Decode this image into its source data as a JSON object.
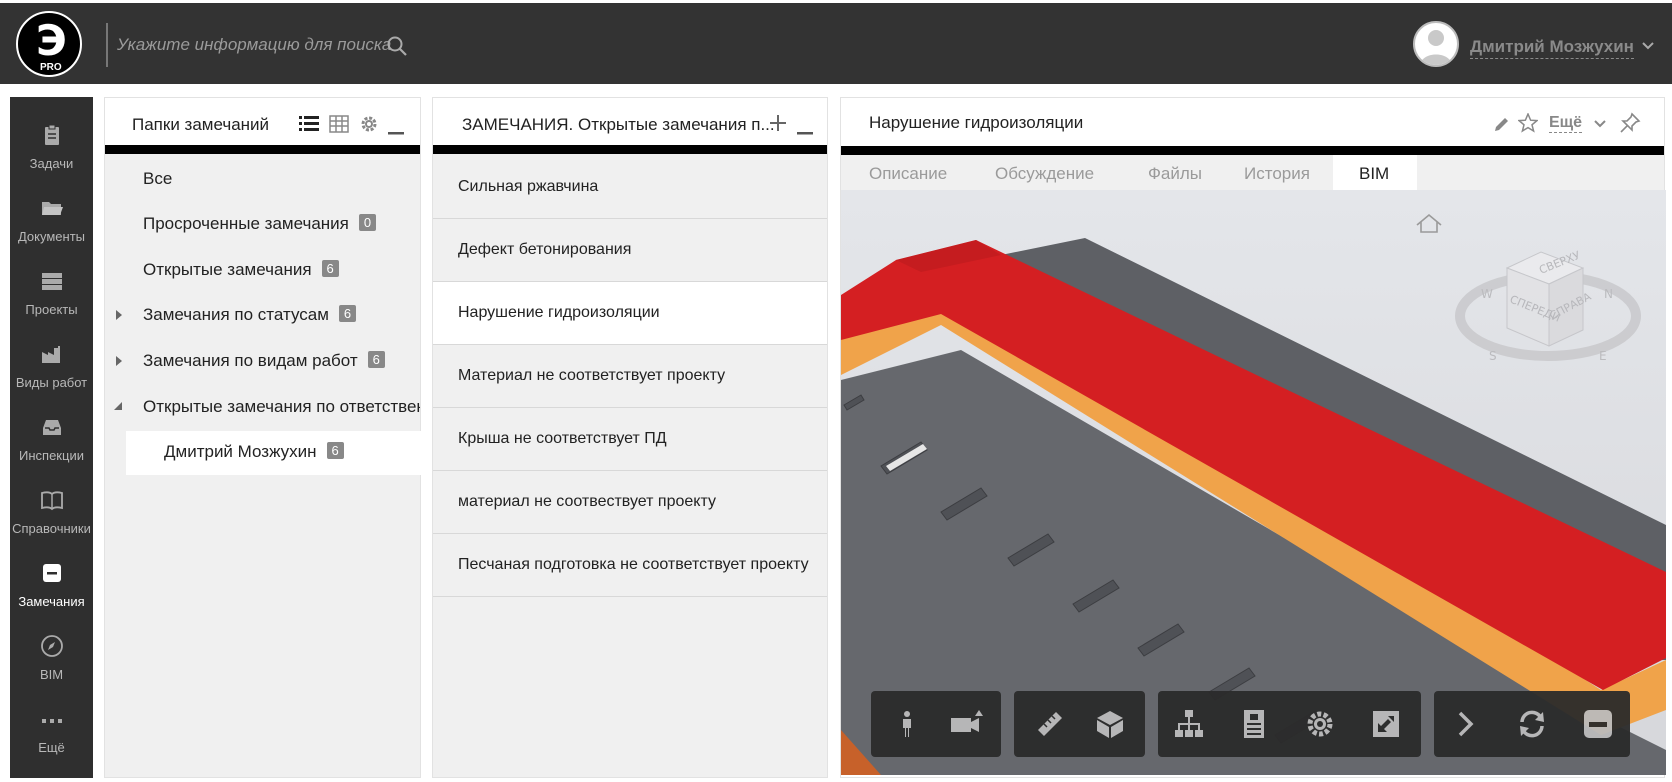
{
  "header": {
    "logo_text": "PRO",
    "search_placeholder": "Укажите информацию для поиска",
    "user_name": "Дмитрий Мозжухин"
  },
  "sidebar": {
    "items": [
      {
        "label": "Задачи",
        "icon": "clipboard-icon"
      },
      {
        "label": "Документы",
        "icon": "folder-icon"
      },
      {
        "label": "Проекты",
        "icon": "server-icon"
      },
      {
        "label": "Виды работ",
        "icon": "factory-icon"
      },
      {
        "label": "Инспекции",
        "icon": "inbox-icon"
      },
      {
        "label": "Справочники",
        "icon": "book-icon"
      },
      {
        "label": "Замечания",
        "icon": "minus-box-icon",
        "active": true
      },
      {
        "label": "BIM",
        "icon": "compass-icon"
      },
      {
        "label": "Ещё",
        "icon": "more-icon"
      }
    ]
  },
  "folders_panel": {
    "title": "Папки замечаний",
    "items": [
      {
        "label": "Все",
        "count": ""
      },
      {
        "label": "Просроченные замечания",
        "count": "0"
      },
      {
        "label": "Открытые замечания",
        "count": "6"
      },
      {
        "label": "Замечания по статусам",
        "count": "6"
      },
      {
        "label": "Замечания по видам работ",
        "count": "6"
      },
      {
        "label": "Открытые замечания по ответственны",
        "count": ""
      },
      {
        "label": "Дмитрий Мозжухин",
        "count": "6"
      }
    ]
  },
  "issues_panel": {
    "title": "ЗАМЕЧАНИЯ. Открытые замечания п...",
    "items": [
      "Сильная ржавчина",
      "Дефект бетонирования",
      "Нарушение гидроизоляции",
      "Материал не соответствует проекту",
      "Крыша не соответствует ПД",
      "материал не соотвествует проекту",
      "Песчаная подготовка не соответствует проекту"
    ],
    "selected_index": 2
  },
  "detail_panel": {
    "title": "Нарушение гидроизоляции",
    "more_label": "Ещё",
    "tabs": [
      "Описание",
      "Обсуждение",
      "Файлы",
      "История",
      "BIM"
    ],
    "active_tab": "BIM",
    "viewcube": {
      "top": "СВЕРХУ",
      "front": "СПЕРЕДИ",
      "right": "СПРАВА",
      "n": "N",
      "s": "S",
      "e": "E",
      "w": "W"
    }
  },
  "colors": {
    "topbar": "#333333",
    "sidebar": "#2f2f2f",
    "roof_red": "#d41f22",
    "roof_gray": "#5e6065",
    "accent_orange": "#f0a34a"
  }
}
